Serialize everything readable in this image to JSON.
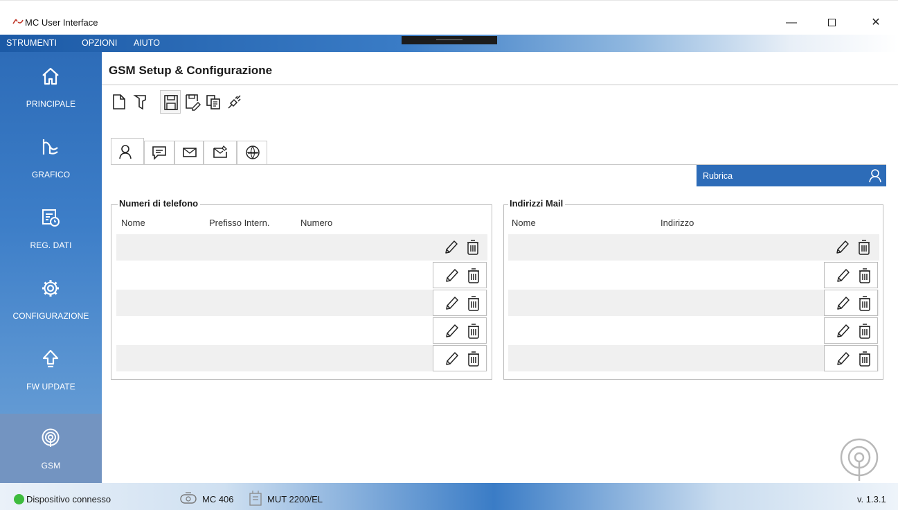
{
  "window": {
    "title": "MC User Interface",
    "app_icon": "mc-logo-icon",
    "controls": {
      "minimize": "—",
      "maximize": "",
      "close": "✕"
    }
  },
  "menu": [
    {
      "label": "STRUMENTI"
    },
    {
      "label": "OPZIONI"
    },
    {
      "label": "AIUTO"
    }
  ],
  "sidebar": {
    "items": [
      {
        "label": "PRINCIPALE",
        "icon": "home-icon",
        "active": false
      },
      {
        "label": "GRAFICO",
        "icon": "chart-icon",
        "active": false
      },
      {
        "label": "REG. DATI",
        "icon": "data-log-icon",
        "active": false
      },
      {
        "label": "CONFIGURAZIONE",
        "icon": "gear-icon",
        "active": false
      },
      {
        "label": "FW UPDATE",
        "icon": "upload-arrow-icon",
        "active": false
      },
      {
        "label": "GSM",
        "icon": "antenna-icon",
        "active": true
      }
    ]
  },
  "page": {
    "title": "GSM Setup & Configurazione"
  },
  "toolbar": {
    "buttons": [
      {
        "icon": "new-file-icon"
      },
      {
        "icon": "open-file-icon"
      },
      {
        "icon": "save-icon"
      },
      {
        "icon": "save-as-icon"
      },
      {
        "icon": "copy-icon"
      },
      {
        "icon": "connect-plug-icon"
      }
    ]
  },
  "tabs": [
    {
      "icon": "contact-icon",
      "selected": true
    },
    {
      "icon": "sms-icon",
      "selected": false
    },
    {
      "icon": "mail-icon",
      "selected": false
    },
    {
      "icon": "mail-settings-icon",
      "selected": false
    },
    {
      "icon": "www-icon",
      "selected": false
    }
  ],
  "rubrica": {
    "label": "Rubrica",
    "icon": "contact-icon"
  },
  "phones": {
    "legend": "Numeri di telefono",
    "columns": [
      "Nome",
      "Prefisso Intern.",
      "Numero"
    ],
    "rows": [
      {
        "nome": "",
        "prefisso": "",
        "numero": ""
      },
      {
        "nome": "",
        "prefisso": "",
        "numero": ""
      },
      {
        "nome": "",
        "prefisso": "",
        "numero": ""
      },
      {
        "nome": "",
        "prefisso": "",
        "numero": ""
      },
      {
        "nome": "",
        "prefisso": "",
        "numero": ""
      }
    ]
  },
  "mails": {
    "legend": "Indirizzi Mail",
    "columns": [
      "Nome",
      "Indirizzo"
    ],
    "rows": [
      {
        "nome": "",
        "indirizzo": ""
      },
      {
        "nome": "",
        "indirizzo": ""
      },
      {
        "nome": "",
        "indirizzo": ""
      },
      {
        "nome": "",
        "indirizzo": ""
      },
      {
        "nome": "",
        "indirizzo": ""
      }
    ]
  },
  "status": {
    "connection": "Dispositivo connesso",
    "connection_color": "#3dbb3d",
    "device": "MC 406",
    "module": "MUT 2200/EL",
    "version": "v. 1.3.1"
  },
  "colors": {
    "sidebar": "#2d6cb8",
    "sidebar_active": "#7394c1",
    "accent": "#2d6cb8"
  }
}
